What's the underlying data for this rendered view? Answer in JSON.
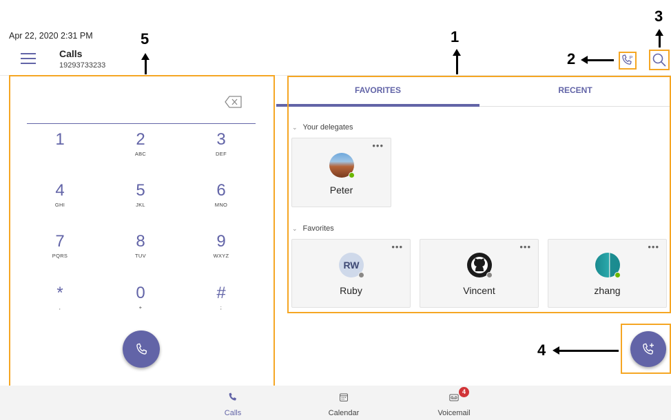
{
  "header": {
    "datetime": "Apr 22, 2020  2:31 PM",
    "title": "Calls",
    "number": "19293733233",
    "park_icon": "call-park-icon",
    "search_icon": "search-icon"
  },
  "annotations": {
    "one": "1",
    "two": "2",
    "three": "3",
    "four": "4",
    "five": "5"
  },
  "dialpad": {
    "keys": [
      {
        "digit": "1",
        "letters": ""
      },
      {
        "digit": "2",
        "letters": "ABC"
      },
      {
        "digit": "3",
        "letters": "DEF"
      },
      {
        "digit": "4",
        "letters": "GHI"
      },
      {
        "digit": "5",
        "letters": "JKL"
      },
      {
        "digit": "6",
        "letters": "MNO"
      },
      {
        "digit": "7",
        "letters": "PQRS"
      },
      {
        "digit": "8",
        "letters": "TUV"
      },
      {
        "digit": "9",
        "letters": "WXYZ"
      },
      {
        "digit": "*",
        "letters": ","
      },
      {
        "digit": "0",
        "letters": "+"
      },
      {
        "digit": "#",
        "letters": ";"
      }
    ]
  },
  "tabs": {
    "favorites": "FAVORITES",
    "recent": "RECENT"
  },
  "sections": {
    "delegates": "Your delegates",
    "favorites": "Favorites"
  },
  "contacts": {
    "peter": {
      "name": "Peter",
      "presence": "available"
    },
    "ruby": {
      "name": "Ruby",
      "initials": "RW",
      "presence": "offline"
    },
    "vincent": {
      "name": "Vincent",
      "presence": "offline"
    },
    "zhang": {
      "name": "zhang",
      "presence": "available"
    }
  },
  "bottom_nav": {
    "calls": "Calls",
    "calendar": "Calendar",
    "voicemail": "Voicemail",
    "voicemail_badge": "4"
  },
  "colors": {
    "accent": "#6264a7",
    "highlight": "#f5a623",
    "available": "#6bb700",
    "offline": "#8a8886",
    "badge": "#d13438"
  }
}
